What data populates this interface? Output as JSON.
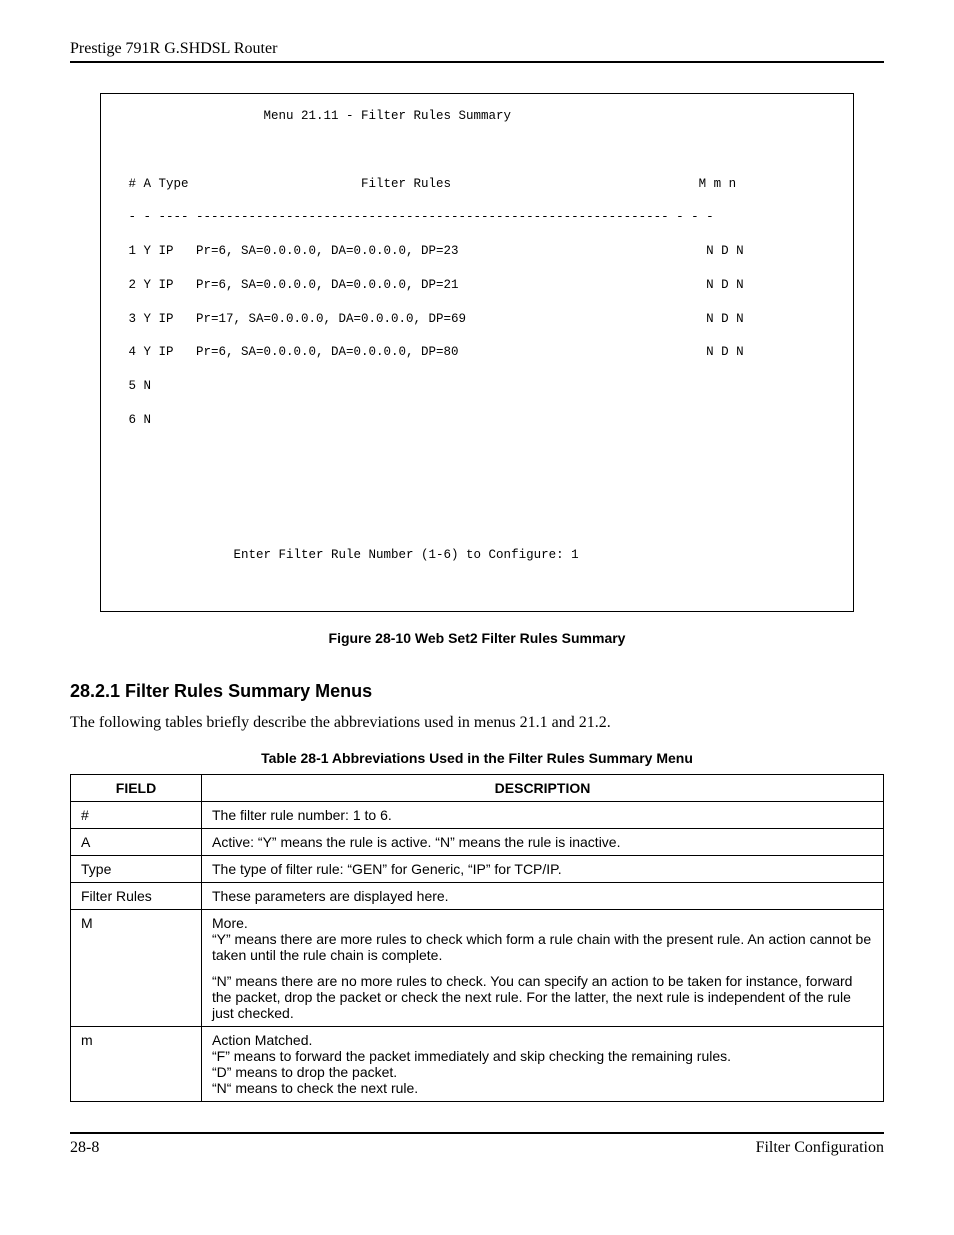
{
  "header": {
    "title": "Prestige 791R G.SHDSL Router"
  },
  "menu": {
    "title": "                   Menu 21.11 - Filter Rules Summary",
    "cols": " # A Type                       Filter Rules                                 M m n",
    "divider": " - - ---- --------------------------------------------------------------- - - -",
    "rows": [
      " 1 Y IP   Pr=6, SA=0.0.0.0, DA=0.0.0.0, DP=23                                 N D N",
      " 2 Y IP   Pr=6, SA=0.0.0.0, DA=0.0.0.0, DP=21                                 N D N",
      " 3 Y IP   Pr=17, SA=0.0.0.0, DA=0.0.0.0, DP=69                                N D N",
      " 4 Y IP   Pr=6, SA=0.0.0.0, DA=0.0.0.0, DP=80                                 N D N",
      " 5 N",
      " 6 N"
    ],
    "prompt": "               Enter Filter Rule Number (1-6) to Configure: 1"
  },
  "figure_caption": "Figure 28-10 Web Set2 Filter Rules Summary",
  "section_heading": "28.2.1 Filter Rules Summary Menus",
  "body_text": "The following tables briefly describe the abbreviations used in menus 21.1 and 21.2.",
  "table_caption": "Table 28-1 Abbreviations Used in the Filter Rules Summary Menu",
  "table": {
    "headers": {
      "field": "FIELD",
      "desc": "DESCRIPTION"
    },
    "rows": [
      {
        "field": "#",
        "desc": [
          [
            "The filter rule number: 1 to 6."
          ]
        ]
      },
      {
        "field": "A",
        "desc": [
          [
            "Active: “Y” means the rule is active. “N” means the rule is inactive."
          ]
        ]
      },
      {
        "field": "Type",
        "desc": [
          [
            "The type of filter rule: “GEN” for Generic, “IP” for TCP/IP."
          ]
        ]
      },
      {
        "field": "Filter Rules",
        "desc": [
          [
            "These parameters are displayed here."
          ]
        ]
      },
      {
        "field": "M",
        "desc": [
          [
            "More.",
            "“Y” means there are more rules to check which form a rule chain with the present rule. An action cannot be taken until the rule chain is complete."
          ],
          [
            "“N” means there are no more rules to check. You can specify an action to be taken for instance, forward the packet, drop the packet or check the next rule. For the latter, the next rule is independent of the rule just checked."
          ]
        ]
      },
      {
        "field": "m",
        "desc": [
          [
            "Action Matched.",
            "“F” means to forward the packet immediately and skip checking the remaining rules.",
            "“D” means to drop the packet.",
            "“N“ means to check the next rule."
          ]
        ]
      }
    ]
  },
  "footer": {
    "left": "28-8",
    "right": "Filter Configuration"
  }
}
